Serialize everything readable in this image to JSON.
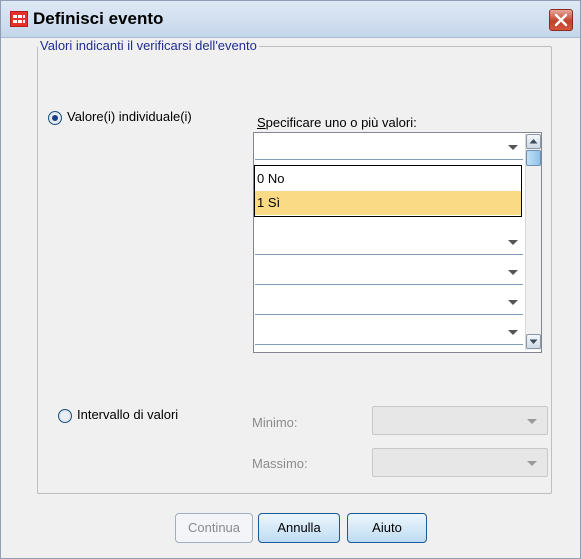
{
  "window": {
    "title": "Definisci evento"
  },
  "group": {
    "label": "Valori indicanti il verificarsi dell'evento"
  },
  "individual": {
    "radio_label": "Valore(i) individuale(i)",
    "selected": true,
    "values_label": "Specificare uno o più valori:",
    "rows": [
      "",
      "",
      "",
      "",
      "",
      "",
      ""
    ]
  },
  "dropdown": {
    "options": [
      "0 No",
      "1 Sì"
    ],
    "highlighted": "1 Sì"
  },
  "range": {
    "radio_label": "Intervallo di valori",
    "selected": false,
    "min_label": "Minimo:",
    "max_label": "Massimo:",
    "min_value": "",
    "max_value": ""
  },
  "buttons": {
    "continue": "Continua",
    "cancel": "Annulla",
    "help": "Aiuto"
  },
  "colors": {
    "highlight": "#fbda85",
    "group_label": "#202e8f",
    "close_button": "#c1422c"
  },
  "icons": [
    "app-grid-icon",
    "close-icon",
    "scroll-up-icon",
    "scroll-down-icon",
    "dropdown-arrow-icon"
  ]
}
